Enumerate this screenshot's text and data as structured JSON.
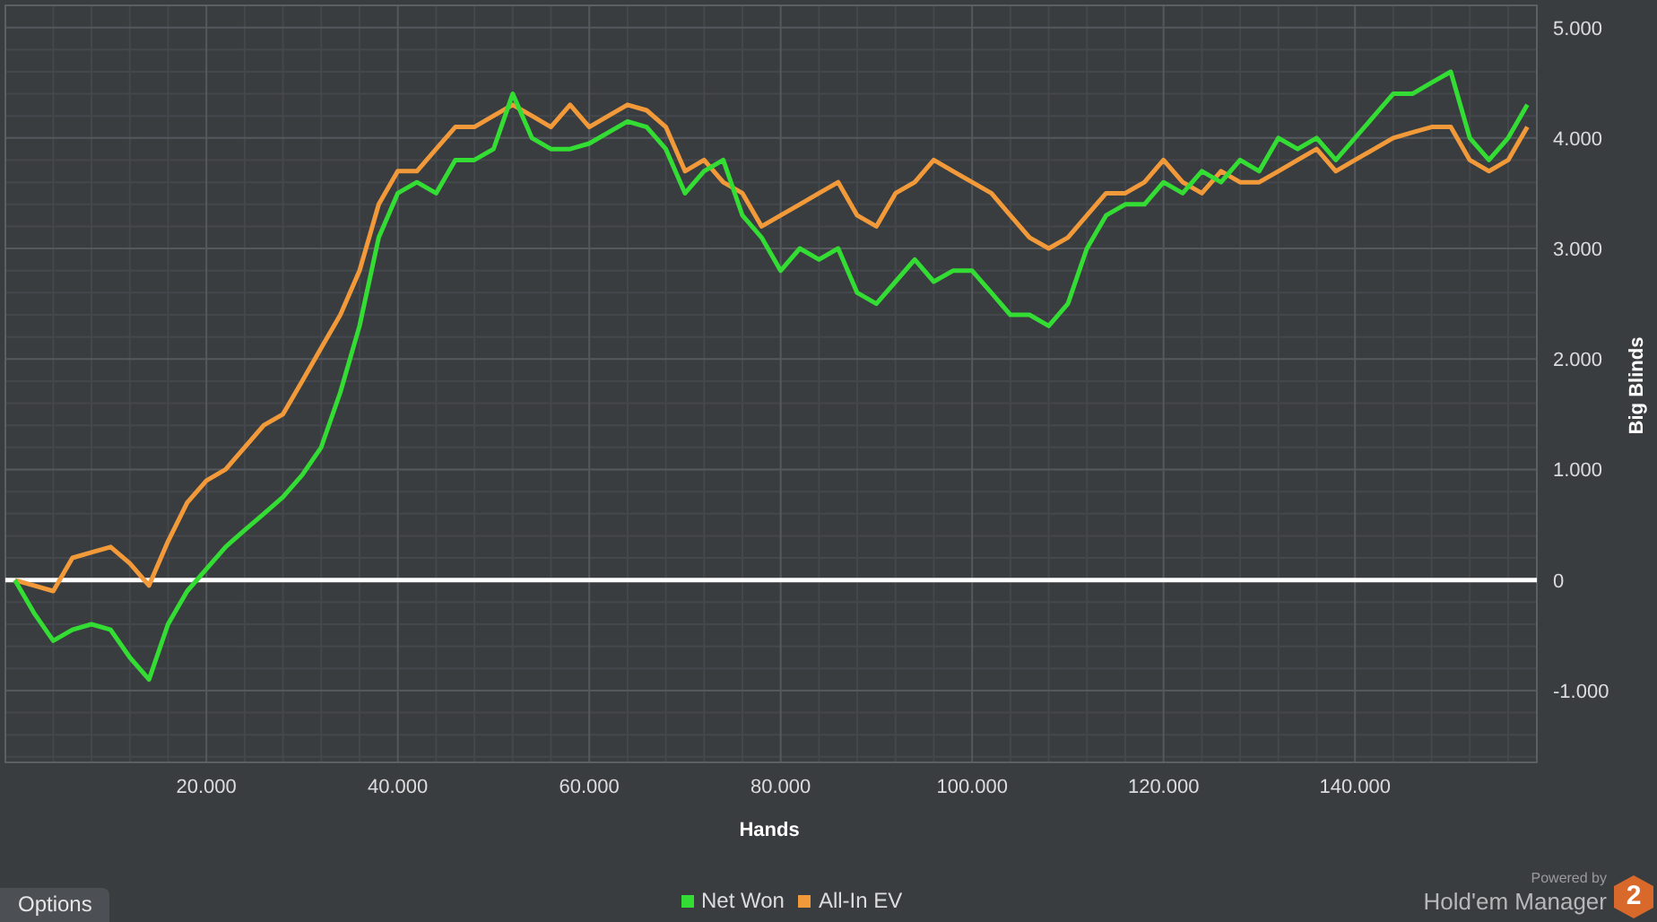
{
  "chart_data": {
    "type": "line",
    "xlabel": "Hands",
    "ylabel": "Big Blinds",
    "x": [
      0,
      2000,
      4000,
      6000,
      8000,
      10000,
      12000,
      14000,
      16000,
      18000,
      20000,
      22000,
      24000,
      26000,
      28000,
      30000,
      32000,
      34000,
      36000,
      38000,
      40000,
      42000,
      44000,
      46000,
      48000,
      50000,
      52000,
      54000,
      56000,
      58000,
      60000,
      62000,
      64000,
      66000,
      68000,
      70000,
      72000,
      74000,
      76000,
      78000,
      80000,
      82000,
      84000,
      86000,
      88000,
      90000,
      92000,
      94000,
      96000,
      98000,
      100000,
      102000,
      104000,
      106000,
      108000,
      110000,
      112000,
      114000,
      116000,
      118000,
      120000,
      122000,
      124000,
      126000,
      128000,
      130000,
      132000,
      134000,
      136000,
      138000,
      140000,
      142000,
      144000,
      146000,
      148000,
      150000,
      152000,
      154000,
      156000,
      158000
    ],
    "series": [
      {
        "name": "Net Won",
        "color": "#33dd33",
        "values": [
          0,
          -300,
          -550,
          -450,
          -400,
          -450,
          -700,
          -900,
          -400,
          -100,
          100,
          300,
          450,
          600,
          750,
          950,
          1200,
          1700,
          2300,
          3100,
          3500,
          3600,
          3500,
          3800,
          3800,
          3900,
          4400,
          4000,
          3900,
          3900,
          3950,
          4050,
          4150,
          4100,
          3900,
          3500,
          3700,
          3800,
          3300,
          3100,
          2800,
          3000,
          2900,
          3000,
          2600,
          2500,
          2700,
          2900,
          2700,
          2800,
          2800,
          2600,
          2400,
          2400,
          2300,
          2500,
          3000,
          3300,
          3400,
          3400,
          3600,
          3500,
          3700,
          3600,
          3800,
          3700,
          4000,
          3900,
          4000,
          3800,
          4000,
          4200,
          4400,
          4400,
          4500,
          4600,
          4000,
          3800,
          4000,
          4300
        ]
      },
      {
        "name": "All-In EV",
        "color": "#f29a3a",
        "values": [
          0,
          -50,
          -100,
          200,
          250,
          300,
          150,
          -50,
          350,
          700,
          900,
          1000,
          1200,
          1400,
          1500,
          1800,
          2100,
          2400,
          2800,
          3400,
          3700,
          3700,
          3900,
          4100,
          4100,
          4200,
          4300,
          4200,
          4100,
          4300,
          4100,
          4200,
          4300,
          4250,
          4100,
          3700,
          3800,
          3600,
          3500,
          3200,
          3300,
          3400,
          3500,
          3600,
          3300,
          3200,
          3500,
          3600,
          3800,
          3700,
          3600,
          3500,
          3300,
          3100,
          3000,
          3100,
          3300,
          3500,
          3500,
          3600,
          3800,
          3600,
          3500,
          3700,
          3600,
          3600,
          3700,
          3800,
          3900,
          3700,
          3800,
          3900,
          4000,
          4050,
          4100,
          4100,
          3800,
          3700,
          3800,
          4100
        ]
      }
    ],
    "xlim": [
      -1000,
      159000
    ],
    "ylim": [
      -1650,
      5200
    ],
    "xticks": [
      {
        "value": 20000,
        "label": "20.000"
      },
      {
        "value": 40000,
        "label": "40.000"
      },
      {
        "value": 60000,
        "label": "60.000"
      },
      {
        "value": 80000,
        "label": "80.000"
      },
      {
        "value": 100000,
        "label": "100.000"
      },
      {
        "value": 120000,
        "label": "120.000"
      },
      {
        "value": 140000,
        "label": "140.000"
      }
    ],
    "yticks": [
      {
        "value": -1000,
        "label": "-1.000"
      },
      {
        "value": 0,
        "label": "0"
      },
      {
        "value": 1000,
        "label": "1.000"
      },
      {
        "value": 2000,
        "label": "2.000"
      },
      {
        "value": 3000,
        "label": "3.000"
      },
      {
        "value": 4000,
        "label": "4.000"
      },
      {
        "value": 5000,
        "label": "5.000"
      }
    ],
    "grid": true,
    "ref_lines": [
      {
        "axis": "y",
        "value": 0
      }
    ]
  },
  "options_button": "Options",
  "branding": {
    "powered_by": "Powered by",
    "product": "Hold'em Manager",
    "badge": "2"
  }
}
